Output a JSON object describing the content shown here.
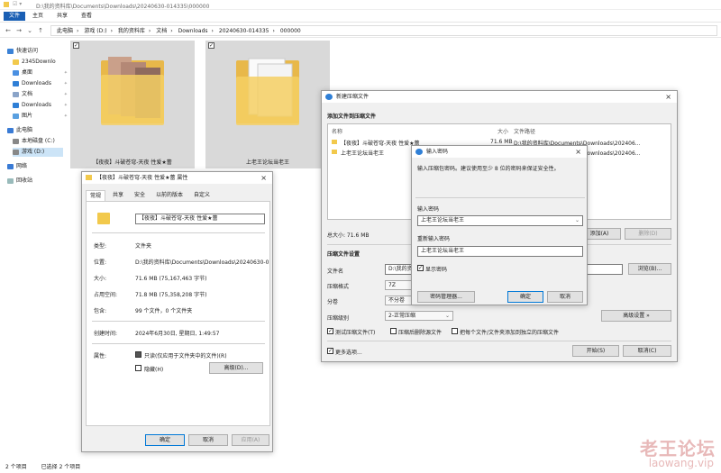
{
  "explorer": {
    "title_path": "D:\\我的资料库\\Documents\\Downloads\\20240630-014335\\000000",
    "ribbon_tabs": [
      "文件",
      "主页",
      "共享",
      "查看"
    ],
    "breadcrumb": [
      "此电脑",
      "游戏 (D:)",
      "我的资料库",
      "文档",
      "Downloads",
      "20240630-014335",
      "000000"
    ],
    "sidebar": [
      {
        "label": "快速访问",
        "icon": "star-icon",
        "pinned": false
      },
      {
        "label": "2345Downlo",
        "icon": "folder-icon",
        "pinned": true
      },
      {
        "label": "桌面",
        "icon": "desktop-icon",
        "pinned": true
      },
      {
        "label": "Downloads",
        "icon": "download-icon",
        "pinned": true
      },
      {
        "label": "文档",
        "icon": "document-icon",
        "pinned": true
      },
      {
        "label": "Downloads",
        "icon": "download-icon",
        "pinned": true
      },
      {
        "label": "图片",
        "icon": "picture-icon",
        "pinned": true
      },
      {
        "label": "此电脑",
        "icon": "computer-icon",
        "pinned": false
      },
      {
        "label": "本地磁盘 (C:)",
        "icon": "drive-icon",
        "pinned": false
      },
      {
        "label": "游戏 (D:)",
        "icon": "drive-icon",
        "pinned": false
      },
      {
        "label": "网络",
        "icon": "network-icon",
        "pinned": false
      },
      {
        "label": "回收站",
        "icon": "recycle-bin-icon",
        "pinned": false
      }
    ],
    "files": [
      {
        "name": "【夜夜】斗破苍穹-天夜 性爱★蕾"
      },
      {
        "name": "上老王论坛当老王"
      }
    ],
    "status": {
      "count": "2 个项目",
      "selected": "已选择 2 个项目"
    }
  },
  "properties": {
    "title": "【夜夜】斗破苍穹-天夜 性爱★蕾 属性",
    "tabs": [
      "常规",
      "共享",
      "安全",
      "以前的版本",
      "自定义"
    ],
    "name_value": "【夜夜】斗破苍穹-天夜 性爱★蕾",
    "rows": [
      {
        "label": "类型:",
        "value": "文件夹"
      },
      {
        "label": "位置:",
        "value": "D:\\我的资料库\\Documents\\Downloads\\20240630-0"
      },
      {
        "label": "大小:",
        "value": "71.6 MB (75,167,463 字节)"
      },
      {
        "label": "占用空间:",
        "value": "71.8 MB (75,358,208 字节)"
      },
      {
        "label": "包含:",
        "value": "99 个文件，0 个文件夹"
      },
      {
        "label": "创建时间:",
        "value": "2024年6月30日, 星期日, 1:49:57"
      }
    ],
    "attributes_label": "属性:",
    "readonly_label": "只读(仅应用于文件夹中的文件)(R)",
    "hidden_label": "隐藏(H)",
    "advanced_button": "高级(D)...",
    "ok": "确定",
    "cancel": "取消",
    "apply": "应用(A)"
  },
  "archive": {
    "title": "新建压缩文件",
    "section_add": "添加文件到压缩文件",
    "col_name": "名称",
    "col_size": "大小",
    "col_path": "文件路径",
    "files": [
      {
        "name": "【夜夜】斗破苍穹-天夜 性爱★蕾",
        "size": "71.6 MB",
        "path": "D:\\我的资料库\\Documents\\Downloads\\202406..."
      },
      {
        "name": "上老王论坛当老王",
        "size": "",
        "path": "D:\\我的资料库\\Documents\\Downloads\\202406..."
      }
    ],
    "total": "总大小: 71.6 MB",
    "add_button": "添加(A)",
    "delete_button": "删除(D)",
    "section_settings": "压缩文件设置",
    "filename_label": "文件名",
    "filename_value": "D:\\我的资",
    "browse_button": "浏览(B)...",
    "format_label": "压缩格式",
    "format_value": "7Z",
    "volume_label": "分卷",
    "volume_value": "不分卷",
    "level_label": "压缩级别",
    "level_value": "2-正常压缩",
    "advanced_button": "高级设置 »",
    "test_label": "测试压缩文件(T)",
    "delete_after_label": "压缩后删除源文件",
    "separate_label": "把每个文件/文件夹添加到独立的压缩文件",
    "more_label": "更多选项...",
    "start_button": "开始(S)",
    "cancel_button": "取消(C)"
  },
  "password": {
    "title": "输入密码",
    "instruction": "输入压缩包密码。建议使用至少 8 位的密码来保证安全性。",
    "enter_label": "输入密码",
    "enter_value": "上老王论坛当老王",
    "reenter_label": "重新输入密码",
    "reenter_value": "上老王论坛当老王",
    "show_label": "显示密码",
    "manager_button": "密码管理器...",
    "ok_button": "确定",
    "cancel_button": "取消"
  },
  "watermark": {
    "main": "老王论坛",
    "sub": "laowang.vip"
  },
  "colors": {
    "accent": "#1a5fb4",
    "folder": "#f2c94c",
    "watermark": "#e8b9b9"
  }
}
